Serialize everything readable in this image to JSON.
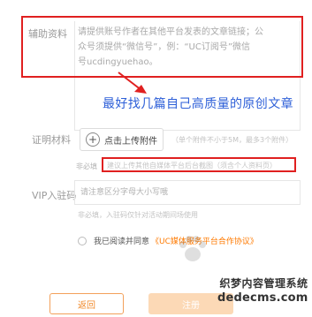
{
  "form": {
    "aux": {
      "label": "辅助资料",
      "text_line1": "请提供账号作者在其他平台发表的文章链接；公",
      "text_line2": "众号须提供“微信号”，例：“UC订阅号”微信",
      "text_line3": "号ucdingyuehao。"
    },
    "annotation": "最好找几篇自己高质量的原创文章",
    "certificate": {
      "label": "证明材料",
      "upload_label": "点击上传附件",
      "upload_limit": "（单个附件不小于5M，最多3个附件）",
      "required_note": "非必填",
      "hint": "建议上传其他自媒体平台后台截图（须含个人资料页）"
    },
    "vip": {
      "label": "VIP入驻码",
      "placeholder": "请注意区分字母大小写哦",
      "note": "非必填，入驻码仅针对活动期间场使用"
    },
    "agreement": {
      "text": "我已阅读并同意",
      "link": "《UC媒体服务平台合作协议》"
    },
    "buttons": {
      "back": "返回",
      "register": "注册"
    }
  },
  "watermark": {
    "line1": "织梦内容管理系统",
    "line2": "dedecms.com"
  },
  "colors": {
    "highlight_box": "#e02020",
    "annotation": "#2d5fd8",
    "accent": "#ff7a00"
  }
}
